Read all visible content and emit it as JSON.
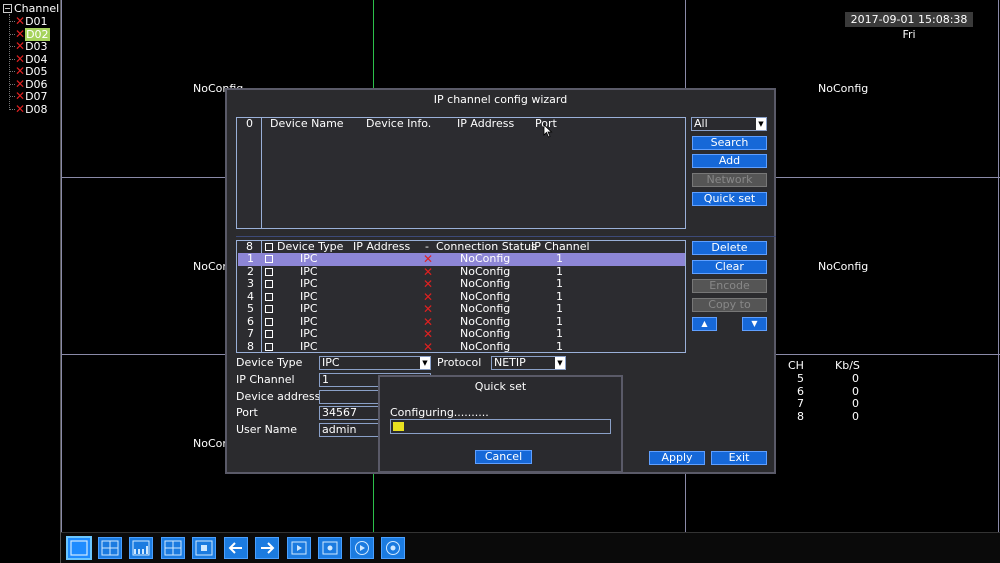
{
  "tree": {
    "root_label": "Channel",
    "items": [
      {
        "label": "D01",
        "selected": false
      },
      {
        "label": "D02",
        "selected": true
      },
      {
        "label": "D03",
        "selected": false
      },
      {
        "label": "D04",
        "selected": false
      },
      {
        "label": "D05",
        "selected": false
      },
      {
        "label": "D06",
        "selected": false
      },
      {
        "label": "D07",
        "selected": false
      },
      {
        "label": "D08",
        "selected": false
      }
    ]
  },
  "datetime": "2017-09-01 15:08:38 Fri",
  "tiles": {
    "noconfig": "NoConfig",
    "partial": "NoCon"
  },
  "stats": {
    "ch_header": "CH",
    "kb_header": "Kb/S",
    "rows": [
      {
        "ch": "5",
        "kb": "0"
      },
      {
        "ch": "6",
        "kb": "0"
      },
      {
        "ch": "7",
        "kb": "0"
      },
      {
        "ch": "8",
        "kb": "0"
      }
    ]
  },
  "dialog": {
    "title": "IP channel config wizard",
    "search_list": {
      "count": "0",
      "headers": [
        "Device Name",
        "Device Info.",
        "IP Address",
        "Port"
      ]
    },
    "filter_value": "All",
    "buttons_top": {
      "search": "Search",
      "add": "Add",
      "network": "Network",
      "quick_set": "Quick set"
    },
    "added_list": {
      "count": "8",
      "headers": [
        "Device Type",
        "IP Address",
        "-",
        "Connection Status",
        "IP Channel"
      ],
      "rows": [
        {
          "num": "1",
          "type": "IPC",
          "status": "NoConfig",
          "channel": "1"
        },
        {
          "num": "2",
          "type": "IPC",
          "status": "NoConfig",
          "channel": "1"
        },
        {
          "num": "3",
          "type": "IPC",
          "status": "NoConfig",
          "channel": "1"
        },
        {
          "num": "4",
          "type": "IPC",
          "status": "NoConfig",
          "channel": "1"
        },
        {
          "num": "5",
          "type": "IPC",
          "status": "NoConfig",
          "channel": "1"
        },
        {
          "num": "6",
          "type": "IPC",
          "status": "NoConfig",
          "channel": "1"
        },
        {
          "num": "7",
          "type": "IPC",
          "status": "NoConfig",
          "channel": "1"
        },
        {
          "num": "8",
          "type": "IPC",
          "status": "NoConfig",
          "channel": "1"
        }
      ]
    },
    "buttons_side": {
      "delete": "Delete",
      "clear": "Clear",
      "encode": "Encode",
      "copy_to": "Copy to",
      "up": "▲",
      "down": "▼"
    },
    "form": {
      "device_type_label": "Device Type",
      "device_type_value": "IPC",
      "protocol_label": "Protocol",
      "protocol_value": "NETIP",
      "ip_channel_label": "IP Channel",
      "ip_channel_value": "1",
      "device_address_label": "Device address",
      "device_address_value": "",
      "port_label": "Port",
      "port_value": "34567",
      "user_name_label": "User Name",
      "user_name_value": "admin"
    },
    "apply": "Apply",
    "exit": "Exit"
  },
  "quickset": {
    "title": "Quick set",
    "message": "Configuring..........",
    "progress": 0.05,
    "cancel": "Cancel"
  },
  "colors": {
    "accent_blue": "#1668d8",
    "selected_row": "#8d86d6",
    "error_red": "#e02020",
    "progress_yellow": "#e8e020"
  }
}
